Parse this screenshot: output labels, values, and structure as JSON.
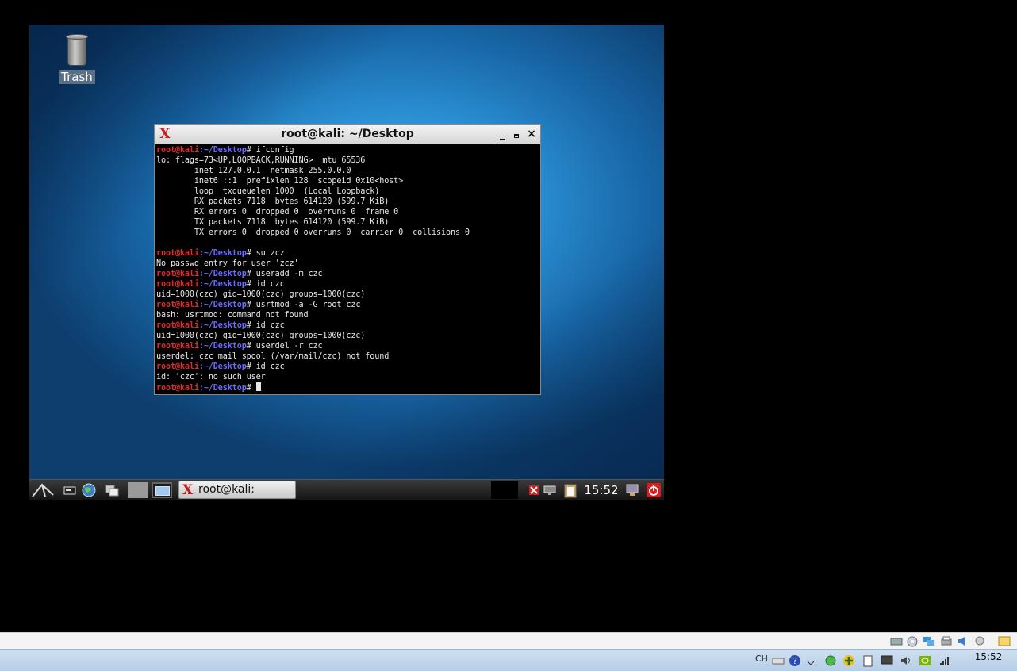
{
  "desktop": {
    "icons": [
      {
        "label": "Trash",
        "icon": "trash-icon"
      }
    ]
  },
  "terminal": {
    "title": "root@kali: ~/Desktop",
    "buttons": {
      "minimize": "‗",
      "maximize": "□",
      "close": "×"
    },
    "prompt_user": "root@kali",
    "prompt_path": ":~/Desktop",
    "prompt_symbol": "# ",
    "lines": [
      {
        "type": "cmd",
        "text": "ifconfig"
      },
      {
        "type": "out",
        "text": "lo: flags=73<UP,LOOPBACK,RUNNING>  mtu 65536"
      },
      {
        "type": "out",
        "text": "        inet 127.0.0.1  netmask 255.0.0.0"
      },
      {
        "type": "out",
        "text": "        inet6 ::1  prefixlen 128  scopeid 0x10<host>"
      },
      {
        "type": "out",
        "text": "        loop  txqueuelen 1000  (Local Loopback)"
      },
      {
        "type": "out",
        "text": "        RX packets 7118  bytes 614120 (599.7 KiB)"
      },
      {
        "type": "out",
        "text": "        RX errors 0  dropped 0  overruns 0  frame 0"
      },
      {
        "type": "out",
        "text": "        TX packets 7118  bytes 614120 (599.7 KiB)"
      },
      {
        "type": "out",
        "text": "        TX errors 0  dropped 0 overruns 0  carrier 0  collisions 0"
      },
      {
        "type": "out",
        "text": ""
      },
      {
        "type": "cmd",
        "text": "su zcz"
      },
      {
        "type": "out",
        "text": "No passwd entry for user 'zcz'"
      },
      {
        "type": "cmd",
        "text": "useradd -m czc"
      },
      {
        "type": "cmd",
        "text": "id czc"
      },
      {
        "type": "out",
        "text": "uid=1000(czc) gid=1000(czc) groups=1000(czc)"
      },
      {
        "type": "cmd",
        "text": "usrtmod -a -G root czc"
      },
      {
        "type": "out",
        "text": "bash: usrtmod: command not found"
      },
      {
        "type": "cmd",
        "text": "id czc"
      },
      {
        "type": "out",
        "text": "uid=1000(czc) gid=1000(czc) groups=1000(czc)"
      },
      {
        "type": "cmd",
        "text": "userdel -r czc"
      },
      {
        "type": "out",
        "text": "userdel: czc mail spool (/var/mail/czc) not found"
      },
      {
        "type": "cmd",
        "text": "id czc"
      },
      {
        "type": "out",
        "text": "id: 'czc': no such user"
      },
      {
        "type": "cmd",
        "text": "",
        "cursor": true
      }
    ]
  },
  "guest_panel": {
    "task_label": "root@kali: ~/De...",
    "clock": "15:52",
    "colors": {
      "power": "#d42020"
    }
  },
  "host_taskbar": {
    "lang": "CH",
    "time": "15:52"
  }
}
